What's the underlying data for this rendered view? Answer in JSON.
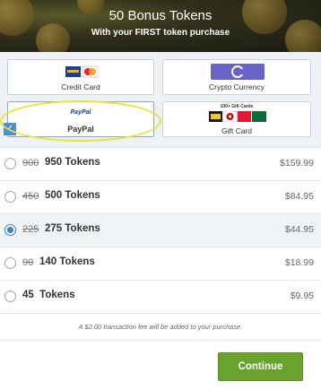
{
  "banner": {
    "title": "50 Bonus Tokens",
    "subtitle": "With your FIRST token purchase"
  },
  "payment_methods": [
    {
      "id": "card",
      "label": "Credit Card",
      "icon": "credit-card-logos-icon",
      "selected": false
    },
    {
      "id": "crypto",
      "label": "Crypto Currency",
      "icon": "crypto-coin-icon",
      "selected": false
    },
    {
      "id": "paypal",
      "label": "PayPal",
      "logo_text": "PayPal",
      "icon": "paypal-logo-icon",
      "selected": true
    },
    {
      "id": "gift",
      "label": "Gift Card",
      "logo_text": "100+ Gift Cards",
      "icon": "gift-card-logos-icon",
      "selected": false
    }
  ],
  "options": [
    {
      "old": "900",
      "tokens": "950 Tokens",
      "price": "$159.99",
      "selected": false
    },
    {
      "old": "450",
      "tokens": "500 Tokens",
      "price": "$84.95",
      "selected": false
    },
    {
      "old": "225",
      "tokens": "275 Tokens",
      "price": "$44.95",
      "selected": true
    },
    {
      "old": "90",
      "tokens": "140 Tokens",
      "price": "$18.99",
      "selected": false
    },
    {
      "old": "",
      "tokens": "45  Tokens",
      "price": "$9.95",
      "selected": false
    }
  ],
  "fee_notice": "A $2.00 transaction fee will be added to your purchase.",
  "continue_label": "Continue",
  "colors": {
    "accent_green": "#6aa22e",
    "accent_blue": "#3b7fc4",
    "highlight_yellow": "#e8e23a"
  }
}
